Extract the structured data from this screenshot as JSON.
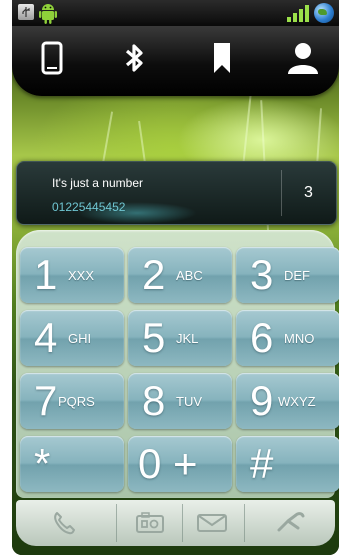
{
  "status_bar": {
    "icons": [
      "usb-icon",
      "android-icon",
      "signal-icon",
      "globe-icon"
    ]
  },
  "top_tabs": {
    "items": [
      {
        "name": "phone-tab",
        "icon": "mobile-phone-icon"
      },
      {
        "name": "bluetooth-tab",
        "icon": "bluetooth-icon"
      },
      {
        "name": "bookmark-tab",
        "icon": "bookmark-icon"
      },
      {
        "name": "contacts-tab",
        "icon": "person-icon"
      }
    ]
  },
  "match_card": {
    "name": "It's just a number",
    "number": "01225445452",
    "count": "3"
  },
  "keypad": {
    "keys": [
      {
        "digit": "1",
        "letters": "XXX"
      },
      {
        "digit": "2",
        "letters": "ABC"
      },
      {
        "digit": "3",
        "letters": "DEF"
      },
      {
        "digit": "4",
        "letters": "GHI"
      },
      {
        "digit": "5",
        "letters": "JKL"
      },
      {
        "digit": "6",
        "letters": "MNO"
      },
      {
        "digit": "7",
        "letters": "PQRS"
      },
      {
        "digit": "8",
        "letters": "TUV"
      },
      {
        "digit": "9",
        "letters": "WXYZ"
      },
      {
        "digit": "*",
        "letters": ""
      },
      {
        "digit": "0 +",
        "letters": ""
      },
      {
        "digit": "#",
        "letters": ""
      }
    ]
  },
  "bottom_bar": {
    "actions": [
      "call-icon",
      "video-call-icon",
      "message-icon",
      "delete-icon"
    ]
  },
  "colors": {
    "key_face": "#86b3bd",
    "keypad_bg": "#cfe2c9",
    "number_text": "#6fc6d2"
  }
}
